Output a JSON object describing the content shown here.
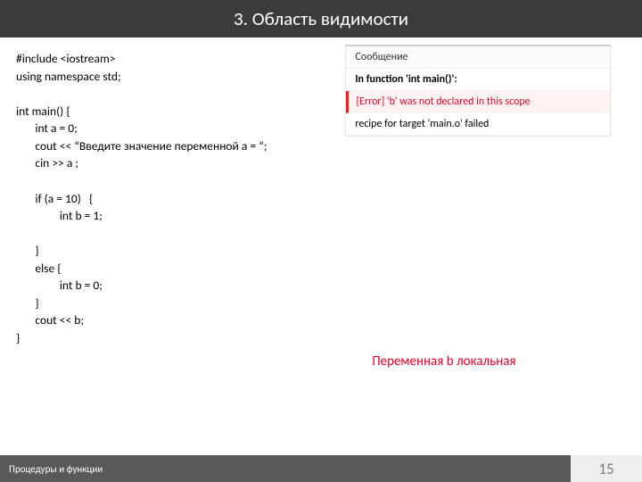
{
  "title": "3. Область видимости",
  "code_lines": [
    "#include <iostream>",
    "using namespace std;",
    "",
    "int main() {",
    "       int a = 0;",
    "       cout << “Введите значение переменной a = “;",
    "       cin >> a ;",
    "",
    "       if (a = 10)   {",
    "                int b = 1;",
    "",
    "       }",
    "       else {",
    "                int b = 0;",
    "       }",
    "       cout << b;",
    "}"
  ],
  "error_panel": {
    "header": "Сообщение",
    "lines": [
      {
        "text": "In function 'int main()':",
        "style": "bold"
      },
      {
        "text": "[Error] 'b' was not declared in this scope",
        "style": "red"
      },
      {
        "text": "recipe for target 'main.o' failed",
        "style": "plain"
      }
    ]
  },
  "note": "Переменная b локальная",
  "footer": {
    "left": "Процедуры и функции",
    "page": "15"
  }
}
